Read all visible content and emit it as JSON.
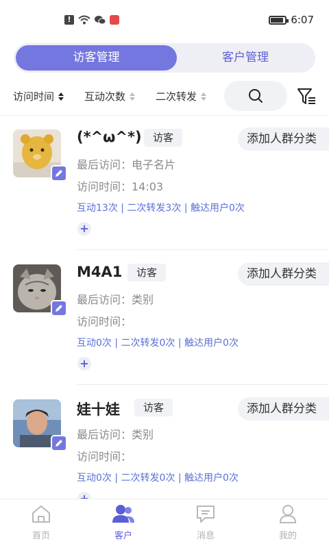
{
  "status_bar": {
    "time": "6:07",
    "notif_icons": [
      "alert-icon",
      "wifi-icon",
      "wechat-icon",
      "app-red-icon"
    ]
  },
  "segment": {
    "active": "访客管理",
    "inactive": "客户管理"
  },
  "filters": {
    "visit_time": "访问时间",
    "interaction_count": "互动次数",
    "reshare": "二次转发"
  },
  "visitors": [
    {
      "name": "(*^ω^*)",
      "tag": "访客",
      "add_group": "添加人群分类",
      "last_visit": "最后访问：电子名片",
      "visit_time": "访问时间：14:03",
      "stats": "互动13次 | 二次转发3次 | 触达用户0次"
    },
    {
      "name": "M4A1",
      "tag": "访客",
      "add_group": "添加人群分类",
      "last_visit": "最后访问：类别",
      "visit_time": "访问时间：",
      "stats": "互动0次 | 二次转发0次 | 触达用户0次"
    },
    {
      "name": "娃十娃",
      "tag": "访客",
      "add_group": "添加人群分类",
      "last_visit": "最后访问：类别",
      "visit_time": "访问时间：",
      "stats": "互动0次 | 二次转发0次 | 触达用户0次"
    }
  ],
  "plus_label": "+",
  "tabbar": {
    "home": "首页",
    "customers": "客户",
    "messages": "消息",
    "mine": "我的"
  },
  "colors": {
    "accent": "#7477e0",
    "accent_text": "#5b5fd6",
    "stats_text": "#5b6fd6"
  }
}
